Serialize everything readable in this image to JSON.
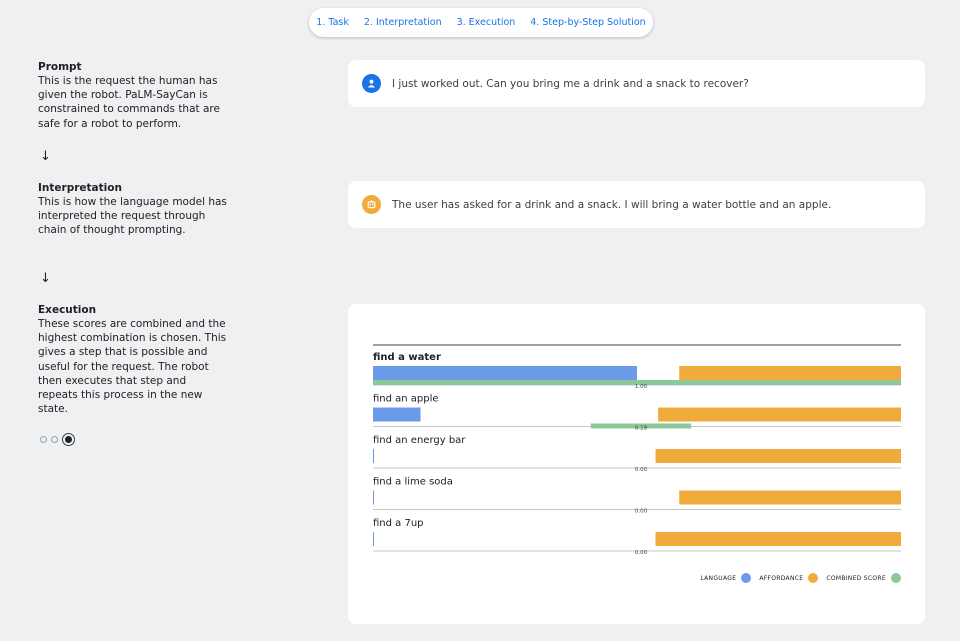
{
  "nav": {
    "tabs": [
      "1. Task",
      "2. Interpretation",
      "3. Execution",
      "4. Step-by-Step Solution"
    ]
  },
  "prompt": {
    "title": "Prompt",
    "description": "This is the request the human has given the robot. PaLM-SayCan is constrained to commands that are safe for a robot to perform.",
    "message": "I just worked out. Can you bring me a drink and a snack to recover?"
  },
  "interpretation": {
    "title": "Interpretation",
    "description": "This is how the language model has interpreted the request through chain of thought prompting.",
    "message": "The user has asked for a drink and a snack. I will bring a water bottle and an apple."
  },
  "execution": {
    "title": "Execution",
    "description": "These scores are combined and the highest combination is chosen. This gives a step that is possible and useful for the request. The robot then executes that step and repeats this process in the new state.",
    "steps_total": 3,
    "steps_active": 3
  },
  "arrow_glyph": "↓",
  "colors": {
    "language": "#6b9be8",
    "affordance": "#f1ab3d",
    "combined": "#8dc89b",
    "accent": "#1a73e8"
  },
  "icons": {
    "user": "person-icon",
    "robot": "robot-icon"
  },
  "chart_data": {
    "type": "bar",
    "categories": [
      "find a water",
      "find an apple",
      "find an energy bar",
      "find a lime soda",
      "find a 7up"
    ],
    "series": [
      {
        "name": "LANGUAGE",
        "values": [
          1.0,
          0.18,
          0.0,
          0.0,
          0.0
        ]
      },
      {
        "name": "AFFORDANCE",
        "values": [
          0.84,
          0.92,
          0.93,
          0.84,
          0.93
        ]
      },
      {
        "name": "COMBINED SCORE",
        "values": [
          1.0,
          0.19,
          0.0,
          0.0,
          0.0
        ]
      }
    ],
    "combined_labels": [
      "1.00",
      "0.19",
      "0.00",
      "0.00",
      "0.00"
    ],
    "selected": 0,
    "legend": [
      "LANGUAGE",
      "AFFORDANCE",
      "COMBINED SCORE"
    ],
    "legend_position": "bottom-right"
  }
}
